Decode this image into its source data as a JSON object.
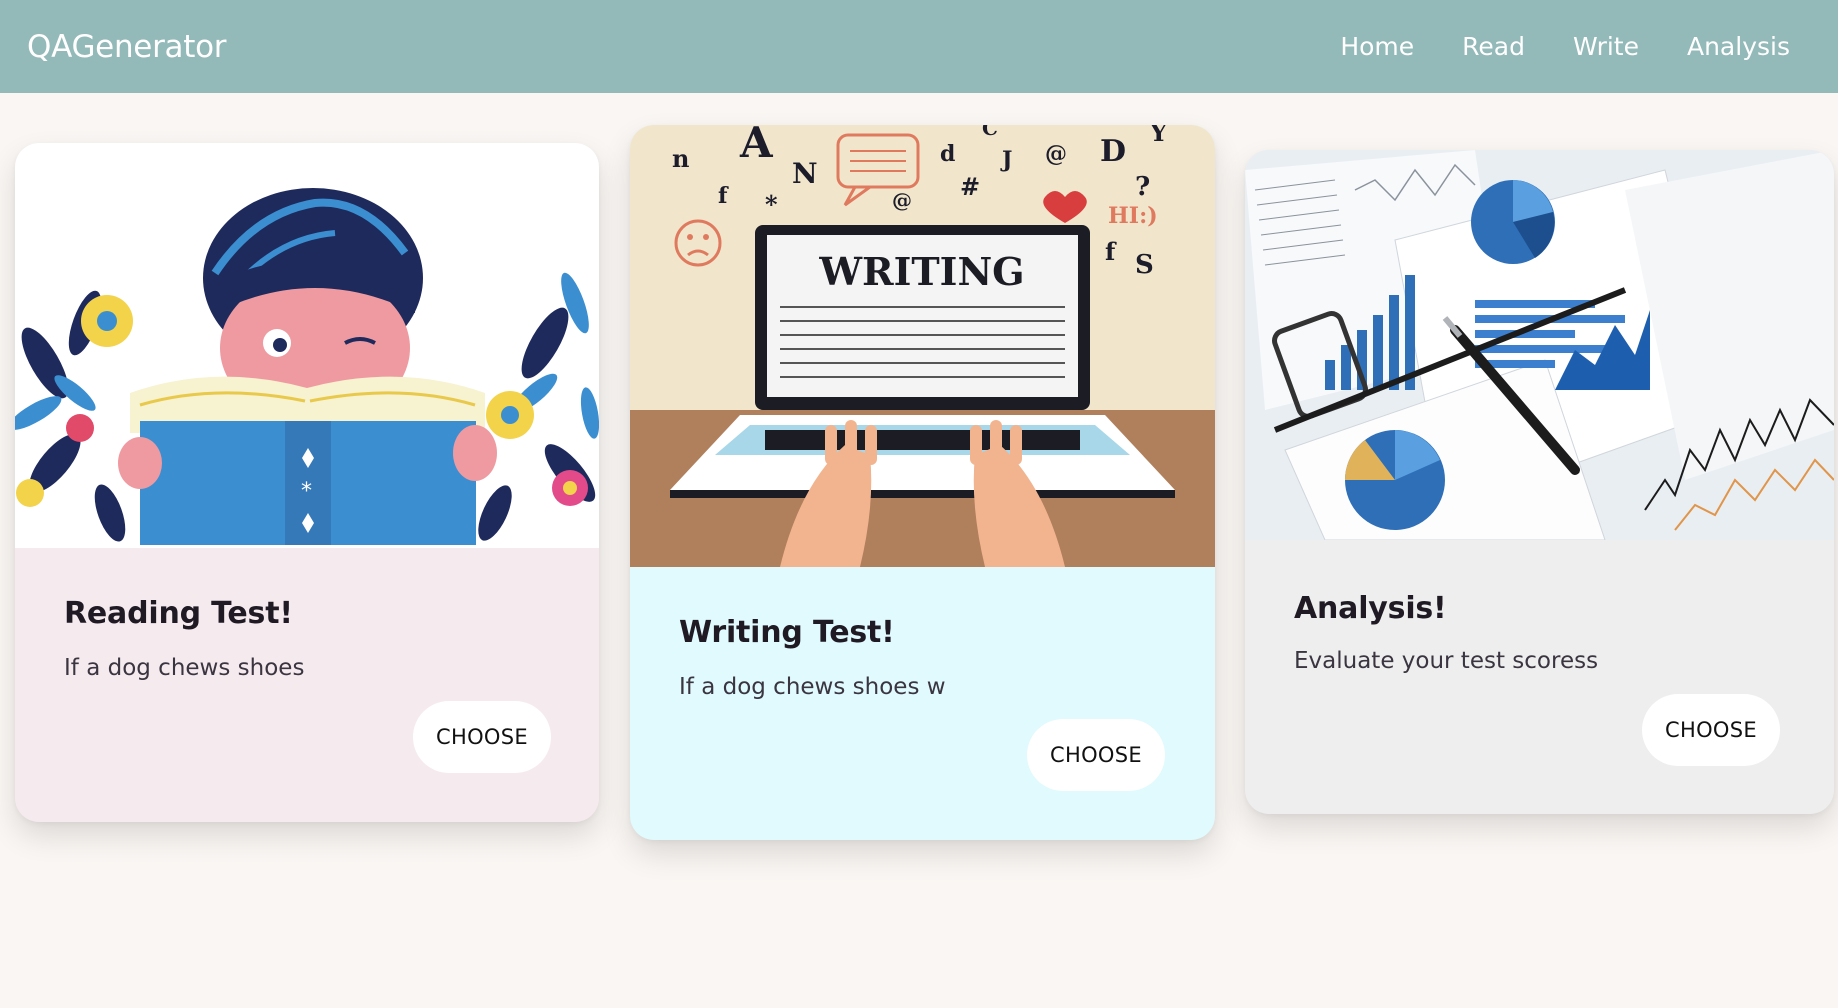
{
  "app": {
    "brand": "QAGenerator"
  },
  "nav": {
    "items": [
      {
        "label": "Home"
      },
      {
        "label": "Read"
      },
      {
        "label": "Write"
      },
      {
        "label": "Analysis"
      }
    ]
  },
  "cards": [
    {
      "title": "Reading Test!",
      "text": "If a dog chews shoes",
      "button": "CHOOSE",
      "image": "reading-illustration",
      "color": "#f5ebee"
    },
    {
      "title": "Writing Test!",
      "text": "If a dog chews shoes w",
      "button": "CHOOSE",
      "image": "writing-illustration",
      "image_text": "WRITING",
      "image_symbols": [
        "n",
        "A",
        "N",
        "d",
        "J",
        "@",
        "D",
        "Y",
        "f",
        "*",
        "#",
        "?",
        "HI:)",
        "f",
        "S",
        "@",
        "C"
      ],
      "color": "#e0fafd"
    },
    {
      "title": "Analysis!",
      "text": "Evaluate your test scoress",
      "button": "CHOOSE",
      "image": "analysis-charts-photo",
      "color": "#eeeeee"
    }
  ],
  "colors": {
    "navbar": "#93b9b8",
    "page_background": "#faf6f3"
  }
}
